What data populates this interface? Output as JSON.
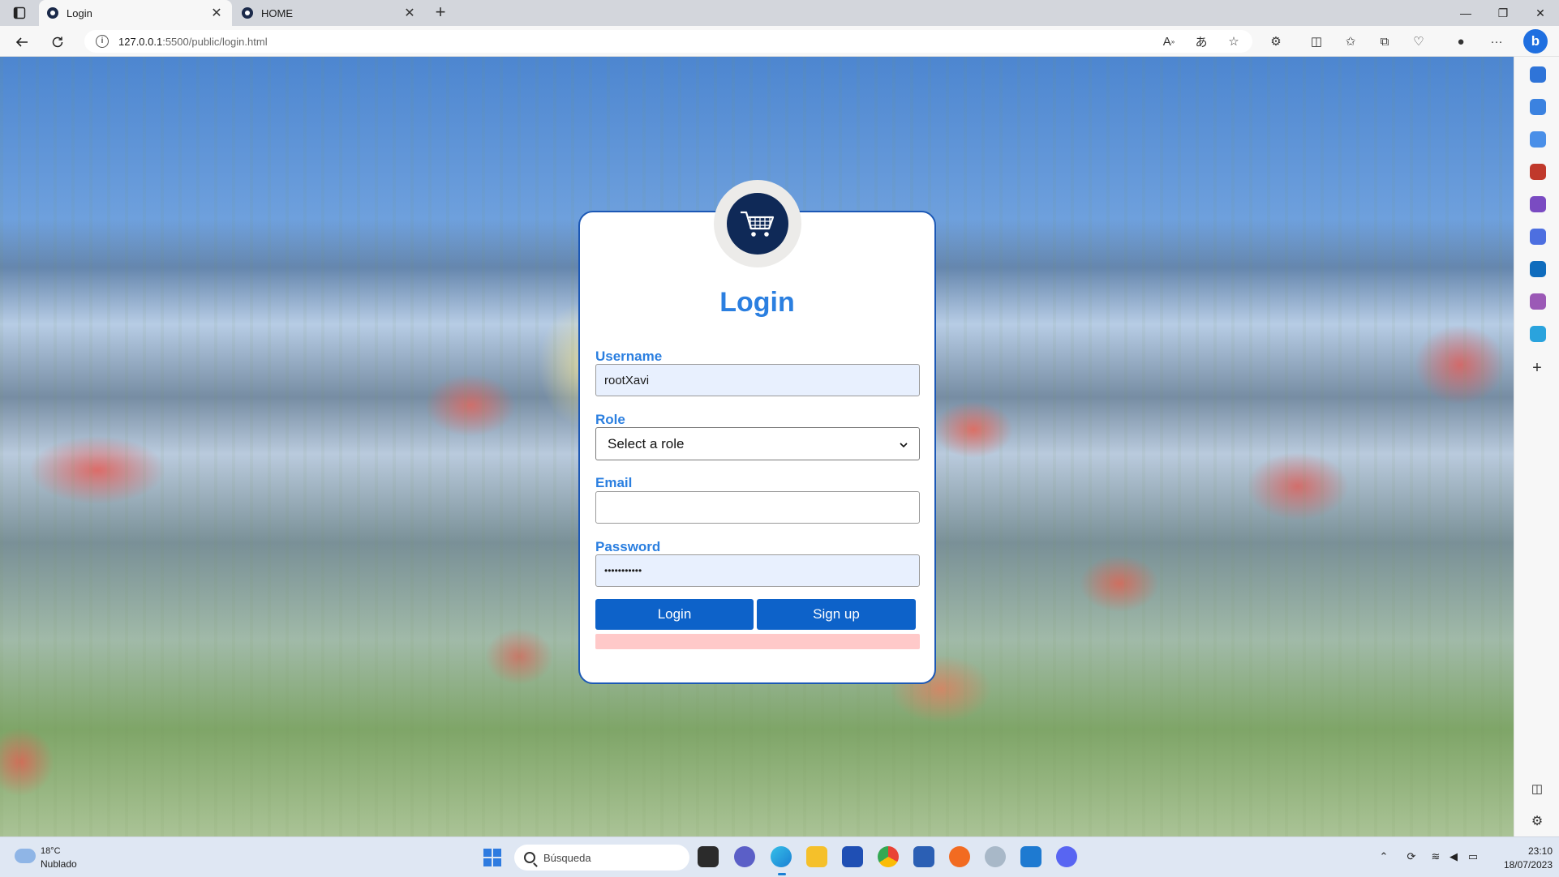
{
  "browser": {
    "tabs": [
      {
        "label": "Login",
        "active": true
      },
      {
        "label": "HOME",
        "active": false
      }
    ],
    "new_tab_glyph": "+",
    "tab_close_glyph": "✕",
    "url_host": "127.0.0.1",
    "url_rest": ":5500/public/login.html",
    "bing_label": "b"
  },
  "login": {
    "title": "Login",
    "username_label": "Username",
    "username_value": "rootXavi",
    "role_label": "Role",
    "role_selected": "Select a role",
    "email_label": "Email",
    "email_value": "",
    "password_label": "Password",
    "password_mask": "•••••••••••",
    "login_button": "Login",
    "signup_button": "Sign up"
  },
  "taskbar": {
    "weather_temp": "18°C",
    "weather_desc": "Nublado",
    "search_placeholder": "Búsqueda",
    "clock_time": "23:10",
    "clock_date": "18/07/2023"
  },
  "colors": {
    "accent": "#2b7fe0",
    "button": "#0d62c9",
    "card_border": "#1c58b5",
    "logo_bg": "#0f2957",
    "error_bar": "#ffc9c9"
  },
  "icons": [
    "cart-icon",
    "back-icon",
    "refresh-icon",
    "info-icon",
    "read-aloud-icon",
    "translate-icon",
    "favorite-star-icon",
    "extensions-icon",
    "split-screen-icon",
    "favorites-icon",
    "collections-icon",
    "performance-icon",
    "profile-icon",
    "more-icon",
    "bell-icon",
    "search-icon",
    "tag-icon",
    "toolbox-icon",
    "games-icon",
    "office-icon",
    "outlook-icon",
    "designer-icon",
    "telegram-icon",
    "add-icon",
    "sidebar-toggle-icon",
    "settings-icon"
  ]
}
